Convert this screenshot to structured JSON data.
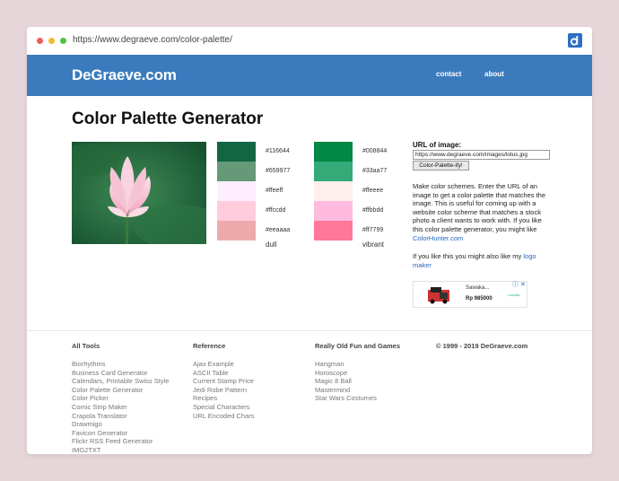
{
  "browser": {
    "url": "https://www.degraeve.com/color-palette/"
  },
  "header": {
    "logo": "DeGraeve.com",
    "nav": [
      "contact",
      "about"
    ]
  },
  "page": {
    "title": "Color Palette Generator"
  },
  "palettes": {
    "dull": {
      "label": "dull",
      "colors": [
        "#116644",
        "#659977",
        "#ffeeff",
        "#ffccdd",
        "#eeaaaa"
      ]
    },
    "vibrant": {
      "label": "vibrant",
      "colors": [
        "#008844",
        "#33aa77",
        "#ffeeee",
        "#ffbbdd",
        "#ff7799"
      ]
    }
  },
  "form": {
    "label": "URL of image:",
    "url_value": "https://www.degraeve.com/images/lotus.jpg",
    "button_label": "Color-Palette-ify!"
  },
  "description": {
    "text": "Make color schemes. Enter the URL of an image to get a color palette that matches the image. This is useful for coming up with a website color scheme that matches a stock photo a client wants to work with. If you like this color palette generator, you might like ",
    "link": "ColorHunter.com",
    "also_text": "If you like this you might also like my ",
    "also_link": "logo maker"
  },
  "ad": {
    "name": "Sawaka...",
    "price": "Rp 985000",
    "close": "ⓘ ✕",
    "brand": "Lazada"
  },
  "footer": {
    "columns": [
      {
        "heading": "All Tools",
        "items": [
          "Biorhythms",
          "Business Card Generator",
          "Calendars, Printable Swiss Style",
          "Color Palette Generator",
          "Color Picker",
          "Comic Strip Maker",
          "Crapola Translator",
          "Drawmigo",
          "Favicon Generator",
          "Flickr RSS Feed Generator",
          "IMG2TXT"
        ]
      },
      {
        "heading": "Reference",
        "items": [
          "Ajax Example",
          "ASCII Table",
          "Current Stamp Price",
          "Jedi Robe Pattern",
          "Recipes",
          "Special Characters",
          "URL Encoded Chars"
        ]
      },
      {
        "heading": "Really Old Fun and Games",
        "items": [
          "Hangman",
          "Horoscope",
          "Magic 8 Ball",
          "Mastermind",
          "Star Wars Costumes"
        ]
      }
    ],
    "copyright": "© 1999 - 2019 DeGraeve.com"
  },
  "colors": {
    "page_bg": "#e6d6d9",
    "header_bg": "#3b7bbd",
    "link": "#2a67c0"
  }
}
